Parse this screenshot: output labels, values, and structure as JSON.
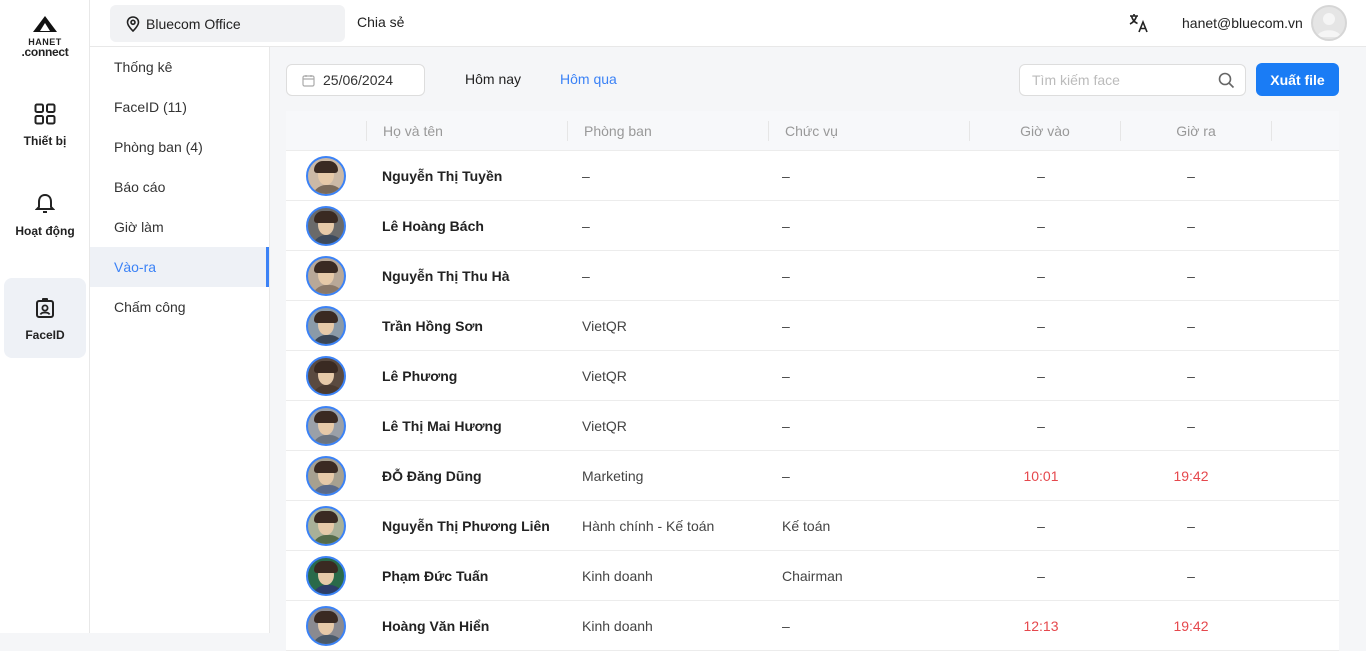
{
  "brand": {
    "line1": "HANET",
    "line2": ".connect"
  },
  "rail": [
    {
      "label": "Thiết bị",
      "icon": "grid-icon",
      "active": false
    },
    {
      "label": "Hoạt động",
      "icon": "bell-icon",
      "active": false
    },
    {
      "label": "FaceID",
      "icon": "badge-icon",
      "active": true
    }
  ],
  "topbar": {
    "location": "Bluecom Office",
    "share": "Chia sẻ",
    "email": "hanet@bluecom.vn"
  },
  "subnav": [
    {
      "label": "Thống kê",
      "active": false
    },
    {
      "label": "FaceID (11)",
      "active": false
    },
    {
      "label": "Phòng ban (4)",
      "active": false
    },
    {
      "label": "Báo cáo",
      "active": false
    },
    {
      "label": "Giờ làm",
      "active": false
    },
    {
      "label": "Vào-ra",
      "active": true
    },
    {
      "label": "Chấm công",
      "active": false
    }
  ],
  "toolbar": {
    "date": "25/06/2024",
    "today": "Hôm nay",
    "yesterday": "Hôm qua",
    "search_placeholder": "Tìm kiếm face",
    "export": "Xuất file"
  },
  "table": {
    "headers": {
      "name": "Họ và tên",
      "dept": "Phòng ban",
      "position": "Chức vụ",
      "in": "Giờ vào",
      "out": "Giờ ra"
    },
    "rows": [
      {
        "name": "Nguyễn Thị Tuyền",
        "dept": "–",
        "position": "–",
        "in": "–",
        "out": "–"
      },
      {
        "name": "Lê Hoàng Bách",
        "dept": "–",
        "position": "–",
        "in": "–",
        "out": "–"
      },
      {
        "name": "Nguyễn Thị Thu Hà",
        "dept": "–",
        "position": "–",
        "in": "–",
        "out": "–"
      },
      {
        "name": "Trần Hồng Sơn",
        "dept": "VietQR",
        "position": "–",
        "in": "–",
        "out": "–"
      },
      {
        "name": "Lê Phương",
        "dept": "VietQR",
        "position": "–",
        "in": "–",
        "out": "–"
      },
      {
        "name": "Lê Thị Mai Hương",
        "dept": "VietQR",
        "position": "–",
        "in": "–",
        "out": "–"
      },
      {
        "name": "ĐỖ Đăng Dũng",
        "dept": "Marketing",
        "position": "–",
        "in": "10:01",
        "out": "19:42"
      },
      {
        "name": "Nguyễn Thị Phương Liên",
        "dept": "Hành chính - Kế toán",
        "position": "Kế toán",
        "in": "–",
        "out": "–"
      },
      {
        "name": "Phạm Đức Tuấn",
        "dept": "Kinh doanh",
        "position": "Chairman",
        "in": "–",
        "out": "–"
      },
      {
        "name": "Hoàng Văn Hiển",
        "dept": "Kinh doanh",
        "position": "–",
        "in": "12:13",
        "out": "19:42"
      }
    ]
  },
  "colors": {
    "accent": "#1a7cf5",
    "late": "#e5484d"
  }
}
